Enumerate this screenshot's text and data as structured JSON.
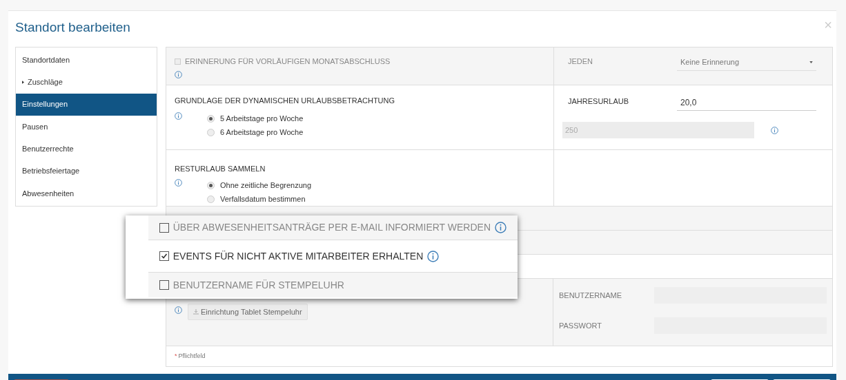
{
  "dialog": {
    "title": "Standort bearbeiten",
    "close": "×"
  },
  "sidebar": {
    "items": [
      {
        "label": "Standortdaten",
        "kind": "link",
        "selected": false
      },
      {
        "label": "Zuschläge",
        "kind": "group",
        "selected": false
      },
      {
        "label": "Einstellungen",
        "kind": "link",
        "selected": true
      },
      {
        "label": "Pausen",
        "kind": "link",
        "selected": false
      },
      {
        "label": "Benutzerrechte",
        "kind": "link",
        "selected": false
      },
      {
        "label": "Betriebsfeiertage",
        "kind": "link",
        "selected": false
      },
      {
        "label": "Abwesenheiten",
        "kind": "link",
        "selected": false
      }
    ]
  },
  "reminder": {
    "label": "ERINNERUNG FÜR VORLÄUFIGEN MONATSABSCHLUSS",
    "checked": false,
    "period_label": "JEDEN",
    "period_value": "Keine Erinnerung"
  },
  "vacation_basis": {
    "label": "GRUNDLAGE DER DYNAMISCHEN URLAUBSBETRACHTUNG",
    "options": [
      {
        "label": "5 Arbeitstage pro Woche",
        "selected": true
      },
      {
        "label": "6 Arbeitstage pro Woche",
        "selected": false
      }
    ],
    "annual_label": "JAHRESURLAUB",
    "annual_value": "20,0",
    "days_value": "250"
  },
  "carryover": {
    "label": "RESTURLAUB SAMMELN",
    "options": [
      {
        "label": "Ohne zeitliche Begrenzung",
        "selected": true
      },
      {
        "label": "Verfallsdatum bestimmen",
        "selected": false
      }
    ]
  },
  "callout": {
    "items": [
      {
        "label": "ÜBER ABWESENHEITSANTRÄGE PER E-MAIL INFORMIERT WERDEN",
        "checked": false,
        "info": true
      },
      {
        "label": "EVENTS FÜR NICHT AKTIVE MITARBEITER ERHALTEN",
        "checked": true,
        "info": true
      },
      {
        "label": "BENUTZERNAME FÜR STEMPELUHR",
        "checked": false,
        "info": false
      }
    ]
  },
  "time_clock": {
    "button": "Einrichtung Tablet Stempeluhr",
    "username_label": "BENUTZERNAME",
    "password_label": "PASSWORT"
  },
  "required_note": {
    "marker": "*",
    "text": "Pflichtfeld"
  }
}
